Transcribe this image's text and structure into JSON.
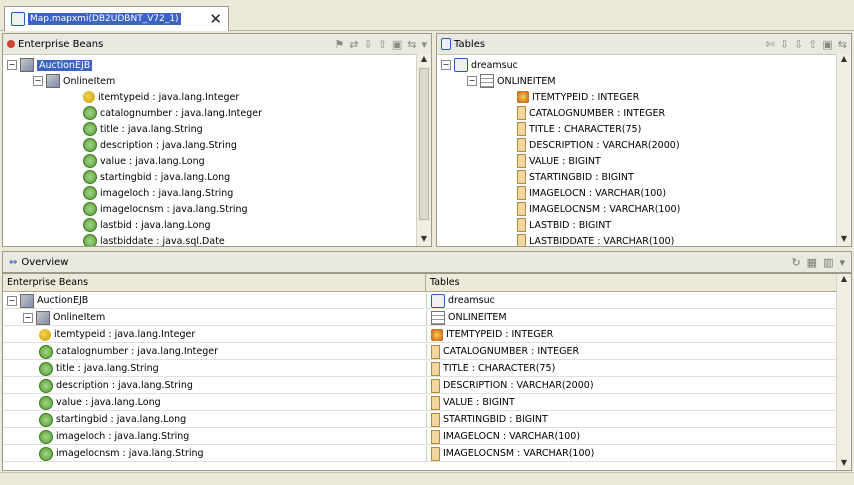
{
  "editor": {
    "tab_title": "Map.mapxmi(DB2UDBNT_V72_1)",
    "close_glyph": "✕"
  },
  "ejb_pane": {
    "title": "Enterprise Beans",
    "root": "AuctionEJB",
    "bean": "OnlineItem",
    "fields": [
      {
        "label": "itemtypeid : java.lang.Integer",
        "key": true
      },
      {
        "label": "catalognumber : java.lang.Integer",
        "key": false
      },
      {
        "label": "title : java.lang.String",
        "key": false
      },
      {
        "label": "description : java.lang.String",
        "key": false
      },
      {
        "label": "value : java.lang.Long",
        "key": false
      },
      {
        "label": "startingbid : java.lang.Long",
        "key": false
      },
      {
        "label": "imageloch : java.lang.String",
        "key": false
      },
      {
        "label": "imagelocnsm : java.lang.String",
        "key": false
      },
      {
        "label": "lastbid : java.lang.Long",
        "key": false
      },
      {
        "label": "lastbiddate : java.sql.Date",
        "key": false
      }
    ]
  },
  "tables_pane": {
    "title": "Tables",
    "root": "dreamsuc",
    "table": "ONLINEITEM",
    "columns": [
      {
        "label": "ITEMTYPEID : INTEGER",
        "key": true
      },
      {
        "label": "CATALOGNUMBER : INTEGER",
        "key": false
      },
      {
        "label": "TITLE : CHARACTER(75)",
        "key": false
      },
      {
        "label": "DESCRIPTION : VARCHAR(2000)",
        "key": false
      },
      {
        "label": "VALUE : BIGINT",
        "key": false
      },
      {
        "label": "STARTINGBID : BIGINT",
        "key": false
      },
      {
        "label": "IMAGELOCN : VARCHAR(100)",
        "key": false
      },
      {
        "label": "IMAGELOCNSM : VARCHAR(100)",
        "key": false
      },
      {
        "label": "LASTBID : BIGINT",
        "key": false
      },
      {
        "label": "LASTBIDDATE : VARCHAR(100)",
        "key": false
      }
    ]
  },
  "overview": {
    "title": "Overview",
    "col_left": "Enterprise Beans",
    "col_right": "Tables",
    "rows": [
      {
        "left": "AuctionEJB",
        "right": "dreamsuc",
        "lkind": "bean",
        "rkind": "db",
        "indent": 0
      },
      {
        "left": "OnlineItem",
        "right": "ONLINEITEM",
        "lkind": "folder",
        "rkind": "table",
        "indent": 1
      },
      {
        "left": "itemtypeid : java.lang.Integer",
        "right": "ITEMTYPEID : INTEGER",
        "lkind": "key",
        "rkind": "pk",
        "indent": 2
      },
      {
        "left": "catalognumber : java.lang.Integer",
        "right": "CATALOGNUMBER : INTEGER",
        "lkind": "field",
        "rkind": "col",
        "indent": 2
      },
      {
        "left": "title : java.lang.String",
        "right": "TITLE : CHARACTER(75)",
        "lkind": "field",
        "rkind": "col",
        "indent": 2
      },
      {
        "left": "description : java.lang.String",
        "right": "DESCRIPTION : VARCHAR(2000)",
        "lkind": "field",
        "rkind": "col",
        "indent": 2
      },
      {
        "left": "value : java.lang.Long",
        "right": "VALUE : BIGINT",
        "lkind": "field",
        "rkind": "col",
        "indent": 2
      },
      {
        "left": "startingbid : java.lang.Long",
        "right": "STARTINGBID : BIGINT",
        "lkind": "field",
        "rkind": "col",
        "indent": 2
      },
      {
        "left": "imageloch : java.lang.String",
        "right": "IMAGELOCN : VARCHAR(100)",
        "lkind": "field",
        "rkind": "col",
        "indent": 2
      },
      {
        "left": "imagelocnsm : java.lang.String",
        "right": "IMAGELOCNSM : VARCHAR(100)",
        "lkind": "field",
        "rkind": "col",
        "indent": 2
      }
    ]
  }
}
